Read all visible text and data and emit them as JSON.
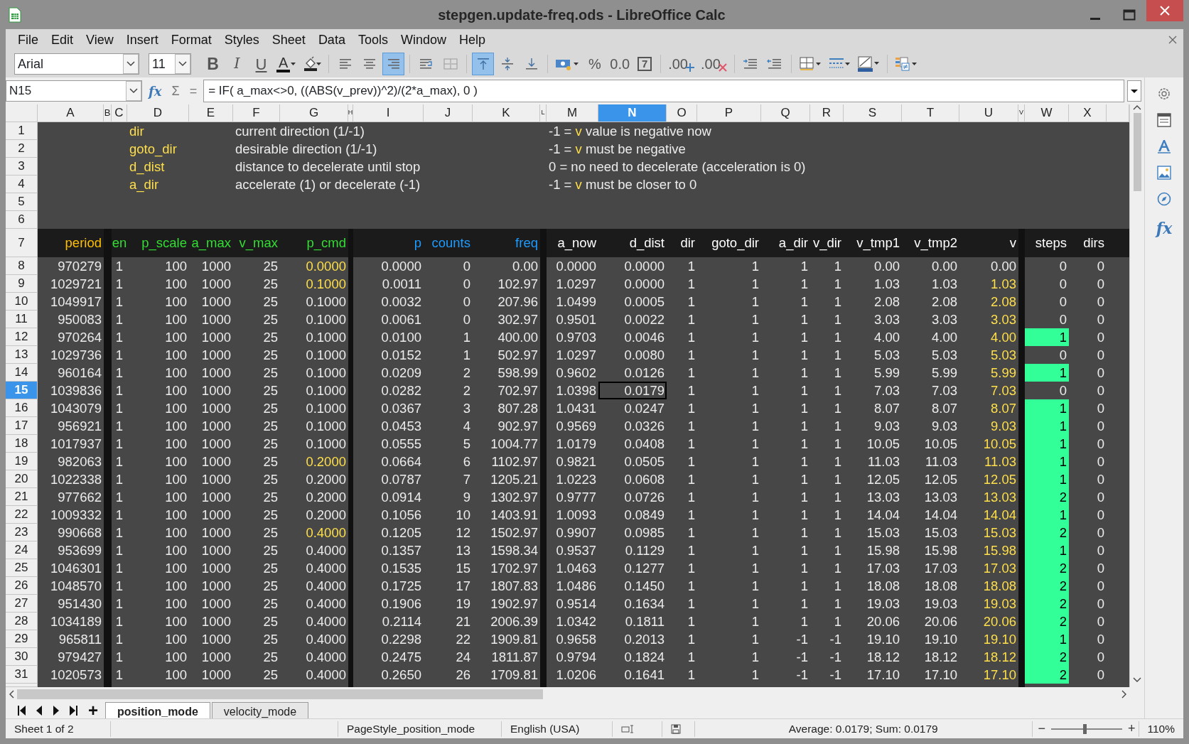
{
  "window": {
    "title": "stepgen.update-freq.ods - LibreOffice Calc"
  },
  "menu": [
    "File",
    "Edit",
    "View",
    "Insert",
    "Format",
    "Styles",
    "Sheet",
    "Data",
    "Tools",
    "Window",
    "Help"
  ],
  "toolbar": {
    "font": "Arial",
    "size": "11",
    "items": [
      {
        "kind": "bold",
        "label": "B"
      },
      {
        "kind": "italic",
        "label": "I"
      },
      {
        "kind": "underline",
        "label": "U"
      },
      {
        "kind": "font-color",
        "label": "A"
      },
      {
        "kind": "highlight"
      },
      {
        "kind": "align-left",
        "selected": false
      },
      {
        "kind": "align-center",
        "selected": false
      },
      {
        "kind": "align-right",
        "selected": true
      },
      {
        "kind": "wrap"
      },
      {
        "kind": "merge"
      },
      {
        "kind": "valign-top",
        "selected": true
      },
      {
        "kind": "valign-center",
        "selected": false
      },
      {
        "kind": "valign-bottom",
        "selected": false
      },
      {
        "kind": "currency"
      },
      {
        "kind": "percent",
        "label": "%"
      },
      {
        "kind": "number",
        "label": "0.0"
      },
      {
        "kind": "date",
        "label": "7"
      },
      {
        "kind": "add-decimal",
        "label": ".00"
      },
      {
        "kind": "delete-decimal",
        "label": ".00"
      },
      {
        "kind": "indent"
      },
      {
        "kind": "outdent"
      },
      {
        "kind": "borders"
      },
      {
        "kind": "border-style"
      },
      {
        "kind": "border-color"
      },
      {
        "kind": "conditional"
      }
    ]
  },
  "formula_bar": {
    "name_box": "N15",
    "buttons": [
      "fx",
      "Σ",
      "="
    ],
    "formula": "= IF( a_max<>0, ((ABS(v_prev))^2)/(2*a_max), 0 )"
  },
  "sidebar": [
    {
      "kind": "settings"
    },
    {
      "kind": "properties"
    },
    {
      "kind": "styles"
    },
    {
      "kind": "gallery"
    },
    {
      "kind": "navigator"
    },
    {
      "kind": "functions",
      "label": "fx"
    }
  ],
  "columns": [
    {
      "letter": "A",
      "selected": false
    },
    {
      "letter": "B",
      "selected": false
    },
    {
      "letter": "C",
      "selected": false
    },
    {
      "letter": "D",
      "selected": false
    },
    {
      "letter": "E",
      "selected": false
    },
    {
      "letter": "F",
      "selected": false
    },
    {
      "letter": "G",
      "selected": false
    },
    {
      "letter": "H",
      "selected": false
    },
    {
      "letter": "I",
      "selected": false
    },
    {
      "letter": "J",
      "selected": false
    },
    {
      "letter": "K",
      "selected": false
    },
    {
      "letter": "L",
      "selected": false
    },
    {
      "letter": "M",
      "selected": false
    },
    {
      "letter": "N",
      "selected": true
    },
    {
      "letter": "O",
      "selected": false
    },
    {
      "letter": "P",
      "selected": false
    },
    {
      "letter": "Q",
      "selected": false
    },
    {
      "letter": "R",
      "selected": false
    },
    {
      "letter": "S",
      "selected": false
    },
    {
      "letter": "T",
      "selected": false
    },
    {
      "letter": "U",
      "selected": false
    },
    {
      "letter": "V",
      "selected": false
    },
    {
      "letter": "W",
      "selected": false
    },
    {
      "letter": "X",
      "selected": false
    }
  ],
  "legend": [
    {
      "n": "1",
      "name": "dir",
      "description": "current direction (1/-1)",
      "note": [
        {
          "kind": "plain",
          "text": "-1 ="
        },
        {
          "kind": "var",
          "text": "v"
        },
        {
          "kind": "plain",
          "text": "value is negative now"
        }
      ]
    },
    {
      "n": "2",
      "name": "goto_dir",
      "description": "desirable direction (1/-1)",
      "note": [
        {
          "kind": "plain",
          "text": "-1 ="
        },
        {
          "kind": "var",
          "text": "v"
        },
        {
          "kind": "plain",
          "text": "must be negative"
        }
      ]
    },
    {
      "n": "3",
      "name": "d_dist",
      "description": "distance to decelerate until stop",
      "note": [
        {
          "kind": "plain",
          "text": "0 = no need to decelerate (acceleration is 0)"
        }
      ]
    },
    {
      "n": "4",
      "name": "a_dir",
      "description": "accelerate (1) or decelerate (-1)",
      "note": [
        {
          "kind": "plain",
          "text": "-1 ="
        },
        {
          "kind": "var",
          "text": "v"
        },
        {
          "kind": "plain",
          "text": "must be closer to 0"
        }
      ]
    }
  ],
  "spacer_rows": [
    "5",
    "6"
  ],
  "header_row": {
    "n": "7",
    "labels": [
      {
        "text": "period",
        "color": "#ffbf00"
      },
      {
        "text": "en",
        "color": "#33dd33"
      },
      {
        "text": "p_scale",
        "color": "#33dd33"
      },
      {
        "text": "a_max",
        "color": "#33dd33"
      },
      {
        "text": "v_max",
        "color": "#33dd33"
      },
      {
        "text": "p_cmd",
        "color": "#33dd33"
      },
      {
        "text": "p",
        "color": "#1e9bff"
      },
      {
        "text": "counts",
        "color": "#1e9bff"
      },
      {
        "text": "freq",
        "color": "#1e9bff"
      },
      {
        "text": "a_now",
        "color": "#ffffff"
      },
      {
        "text": "d_dist",
        "color": "#ffffff"
      },
      {
        "text": "dir",
        "color": "#ffffff"
      },
      {
        "text": "goto_dir",
        "color": "#ffffff"
      },
      {
        "text": "a_dir",
        "color": "#ffffff"
      },
      {
        "text": "v_dir",
        "color": "#ffffff"
      },
      {
        "text": "v_tmp1",
        "color": "#ffffff"
      },
      {
        "text": "v_tmp2",
        "color": "#ffffff"
      },
      {
        "text": "v",
        "color": "#ffffff"
      },
      {
        "text": "steps",
        "color": "#ffffff"
      },
      {
        "text": "dirs",
        "color": "#ffffff"
      }
    ]
  },
  "rows": [
    {
      "n": "8",
      "selected": false,
      "p_cmd_changed": true,
      "v_nonzero": false,
      "steps_on": false,
      "cells": [
        "970279",
        "1",
        "100",
        "1000",
        "25",
        "0.0000",
        "0.0000",
        "0",
        "0.00",
        "0.0000",
        "0.0000",
        "1",
        "1",
        "1",
        "1",
        "0.00",
        "0.00",
        "0.00",
        "0",
        "0"
      ]
    },
    {
      "n": "9",
      "selected": false,
      "p_cmd_changed": true,
      "v_nonzero": true,
      "steps_on": false,
      "cells": [
        "1029721",
        "1",
        "100",
        "1000",
        "25",
        "0.1000",
        "0.0011",
        "0",
        "102.97",
        "1.0297",
        "0.0000",
        "1",
        "1",
        "1",
        "1",
        "1.03",
        "1.03",
        "1.03",
        "0",
        "0"
      ]
    },
    {
      "n": "10",
      "selected": false,
      "p_cmd_changed": false,
      "v_nonzero": true,
      "steps_on": false,
      "cells": [
        "1049917",
        "1",
        "100",
        "1000",
        "25",
        "0.1000",
        "0.0032",
        "0",
        "207.96",
        "1.0499",
        "0.0005",
        "1",
        "1",
        "1",
        "1",
        "2.08",
        "2.08",
        "2.08",
        "0",
        "0"
      ]
    },
    {
      "n": "11",
      "selected": false,
      "p_cmd_changed": false,
      "v_nonzero": true,
      "steps_on": false,
      "cells": [
        "950083",
        "1",
        "100",
        "1000",
        "25",
        "0.1000",
        "0.0061",
        "0",
        "302.97",
        "0.9501",
        "0.0022",
        "1",
        "1",
        "1",
        "1",
        "3.03",
        "3.03",
        "3.03",
        "0",
        "0"
      ]
    },
    {
      "n": "12",
      "selected": false,
      "p_cmd_changed": false,
      "v_nonzero": true,
      "steps_on": true,
      "cells": [
        "970264",
        "1",
        "100",
        "1000",
        "25",
        "0.1000",
        "0.0100",
        "1",
        "400.00",
        "0.9703",
        "0.0046",
        "1",
        "1",
        "1",
        "1",
        "4.00",
        "4.00",
        "4.00",
        "1",
        "0"
      ]
    },
    {
      "n": "13",
      "selected": false,
      "p_cmd_changed": false,
      "v_nonzero": true,
      "steps_on": false,
      "cells": [
        "1029736",
        "1",
        "100",
        "1000",
        "25",
        "0.1000",
        "0.0152",
        "1",
        "502.97",
        "1.0297",
        "0.0080",
        "1",
        "1",
        "1",
        "1",
        "5.03",
        "5.03",
        "5.03",
        "0",
        "0"
      ]
    },
    {
      "n": "14",
      "selected": false,
      "p_cmd_changed": false,
      "v_nonzero": true,
      "steps_on": true,
      "cells": [
        "960164",
        "1",
        "100",
        "1000",
        "25",
        "0.1000",
        "0.0209",
        "2",
        "598.99",
        "0.9602",
        "0.0126",
        "1",
        "1",
        "1",
        "1",
        "5.99",
        "5.99",
        "5.99",
        "1",
        "0"
      ]
    },
    {
      "n": "15",
      "selected": true,
      "p_cmd_changed": false,
      "v_nonzero": true,
      "steps_on": false,
      "cells": [
        "1039836",
        "1",
        "100",
        "1000",
        "25",
        "0.1000",
        "0.0282",
        "2",
        "702.97",
        "1.0398",
        "0.0179",
        "1",
        "1",
        "1",
        "1",
        "7.03",
        "7.03",
        "7.03",
        "0",
        "0"
      ]
    },
    {
      "n": "16",
      "selected": false,
      "p_cmd_changed": false,
      "v_nonzero": true,
      "steps_on": true,
      "cells": [
        "1043079",
        "1",
        "100",
        "1000",
        "25",
        "0.1000",
        "0.0367",
        "3",
        "807.28",
        "1.0431",
        "0.0247",
        "1",
        "1",
        "1",
        "1",
        "8.07",
        "8.07",
        "8.07",
        "1",
        "0"
      ]
    },
    {
      "n": "17",
      "selected": false,
      "p_cmd_changed": false,
      "v_nonzero": true,
      "steps_on": true,
      "cells": [
        "956921",
        "1",
        "100",
        "1000",
        "25",
        "0.1000",
        "0.0453",
        "4",
        "902.97",
        "0.9569",
        "0.0326",
        "1",
        "1",
        "1",
        "1",
        "9.03",
        "9.03",
        "9.03",
        "1",
        "0"
      ]
    },
    {
      "n": "18",
      "selected": false,
      "p_cmd_changed": false,
      "v_nonzero": true,
      "steps_on": true,
      "cells": [
        "1017937",
        "1",
        "100",
        "1000",
        "25",
        "0.1000",
        "0.0555",
        "5",
        "1004.77",
        "1.0179",
        "0.0408",
        "1",
        "1",
        "1",
        "1",
        "10.05",
        "10.05",
        "10.05",
        "1",
        "0"
      ]
    },
    {
      "n": "19",
      "selected": false,
      "p_cmd_changed": true,
      "v_nonzero": true,
      "steps_on": true,
      "cells": [
        "982063",
        "1",
        "100",
        "1000",
        "25",
        "0.2000",
        "0.0664",
        "6",
        "1102.97",
        "0.9821",
        "0.0505",
        "1",
        "1",
        "1",
        "1",
        "11.03",
        "11.03",
        "11.03",
        "1",
        "0"
      ]
    },
    {
      "n": "20",
      "selected": false,
      "p_cmd_changed": false,
      "v_nonzero": true,
      "steps_on": true,
      "cells": [
        "1022338",
        "1",
        "100",
        "1000",
        "25",
        "0.2000",
        "0.0787",
        "7",
        "1205.21",
        "1.0223",
        "0.0608",
        "1",
        "1",
        "1",
        "1",
        "12.05",
        "12.05",
        "12.05",
        "1",
        "0"
      ]
    },
    {
      "n": "21",
      "selected": false,
      "p_cmd_changed": false,
      "v_nonzero": true,
      "steps_on": true,
      "cells": [
        "977662",
        "1",
        "100",
        "1000",
        "25",
        "0.2000",
        "0.0914",
        "9",
        "1302.97",
        "0.9777",
        "0.0726",
        "1",
        "1",
        "1",
        "1",
        "13.03",
        "13.03",
        "13.03",
        "2",
        "0"
      ]
    },
    {
      "n": "22",
      "selected": false,
      "p_cmd_changed": false,
      "v_nonzero": true,
      "steps_on": true,
      "cells": [
        "1009332",
        "1",
        "100",
        "1000",
        "25",
        "0.2000",
        "0.1056",
        "10",
        "1403.91",
        "1.0093",
        "0.0849",
        "1",
        "1",
        "1",
        "1",
        "14.04",
        "14.04",
        "14.04",
        "1",
        "0"
      ]
    },
    {
      "n": "23",
      "selected": false,
      "p_cmd_changed": true,
      "v_nonzero": true,
      "steps_on": true,
      "cells": [
        "990668",
        "1",
        "100",
        "1000",
        "25",
        "0.4000",
        "0.1205",
        "12",
        "1502.97",
        "0.9907",
        "0.0985",
        "1",
        "1",
        "1",
        "1",
        "15.03",
        "15.03",
        "15.03",
        "2",
        "0"
      ]
    },
    {
      "n": "24",
      "selected": false,
      "p_cmd_changed": false,
      "v_nonzero": true,
      "steps_on": true,
      "cells": [
        "953699",
        "1",
        "100",
        "1000",
        "25",
        "0.4000",
        "0.1357",
        "13",
        "1598.34",
        "0.9537",
        "0.1129",
        "1",
        "1",
        "1",
        "1",
        "15.98",
        "15.98",
        "15.98",
        "1",
        "0"
      ]
    },
    {
      "n": "25",
      "selected": false,
      "p_cmd_changed": false,
      "v_nonzero": true,
      "steps_on": true,
      "cells": [
        "1046301",
        "1",
        "100",
        "1000",
        "25",
        "0.4000",
        "0.1535",
        "15",
        "1702.97",
        "1.0463",
        "0.1277",
        "1",
        "1",
        "1",
        "1",
        "17.03",
        "17.03",
        "17.03",
        "2",
        "0"
      ]
    },
    {
      "n": "26",
      "selected": false,
      "p_cmd_changed": false,
      "v_nonzero": true,
      "steps_on": true,
      "cells": [
        "1048570",
        "1",
        "100",
        "1000",
        "25",
        "0.4000",
        "0.1725",
        "17",
        "1807.83",
        "1.0486",
        "0.1450",
        "1",
        "1",
        "1",
        "1",
        "18.08",
        "18.08",
        "18.08",
        "2",
        "0"
      ]
    },
    {
      "n": "27",
      "selected": false,
      "p_cmd_changed": false,
      "v_nonzero": true,
      "steps_on": true,
      "cells": [
        "951430",
        "1",
        "100",
        "1000",
        "25",
        "0.4000",
        "0.1906",
        "19",
        "1902.97",
        "0.9514",
        "0.1634",
        "1",
        "1",
        "1",
        "1",
        "19.03",
        "19.03",
        "19.03",
        "2",
        "0"
      ]
    },
    {
      "n": "28",
      "selected": false,
      "p_cmd_changed": false,
      "v_nonzero": true,
      "steps_on": true,
      "cells": [
        "1034189",
        "1",
        "100",
        "1000",
        "25",
        "0.4000",
        "0.2114",
        "21",
        "2006.39",
        "1.0342",
        "0.1811",
        "1",
        "1",
        "1",
        "1",
        "20.06",
        "20.06",
        "20.06",
        "2",
        "0"
      ]
    },
    {
      "n": "29",
      "selected": false,
      "p_cmd_changed": false,
      "v_nonzero": true,
      "steps_on": true,
      "cells": [
        "965811",
        "1",
        "100",
        "1000",
        "25",
        "0.4000",
        "0.2298",
        "22",
        "1909.81",
        "0.9658",
        "0.2013",
        "1",
        "1",
        "-1",
        "-1",
        "19.10",
        "19.10",
        "19.10",
        "1",
        "0"
      ]
    },
    {
      "n": "30",
      "selected": false,
      "p_cmd_changed": false,
      "v_nonzero": true,
      "steps_on": true,
      "cells": [
        "979427",
        "1",
        "100",
        "1000",
        "25",
        "0.4000",
        "0.2475",
        "24",
        "1811.87",
        "0.9794",
        "0.1824",
        "1",
        "1",
        "-1",
        "-1",
        "18.12",
        "18.12",
        "18.12",
        "2",
        "0"
      ]
    },
    {
      "n": "31",
      "selected": false,
      "p_cmd_changed": false,
      "v_nonzero": true,
      "steps_on": true,
      "cells": [
        "1020573",
        "1",
        "100",
        "1000",
        "25",
        "0.4000",
        "0.2650",
        "26",
        "1709.81",
        "1.0206",
        "0.1641",
        "1",
        "1",
        "-1",
        "-1",
        "17.10",
        "17.10",
        "17.10",
        "2",
        "0"
      ]
    }
  ],
  "sheet_tabs": [
    {
      "label": "position_mode",
      "selected": true
    },
    {
      "label": "velocity_mode",
      "selected": false
    }
  ],
  "add_sheet": "+",
  "status_bar": {
    "sheet": "Sheet 1 of 2",
    "page_style": "PageStyle_position_mode",
    "language": "English (USA)",
    "summary": "Average: 0.0179; Sum: 0.0179",
    "zoom_out": "−",
    "zoom_in": "+",
    "zoom": {
      "level": 0.47
    },
    "zoom_percent": "110%"
  }
}
